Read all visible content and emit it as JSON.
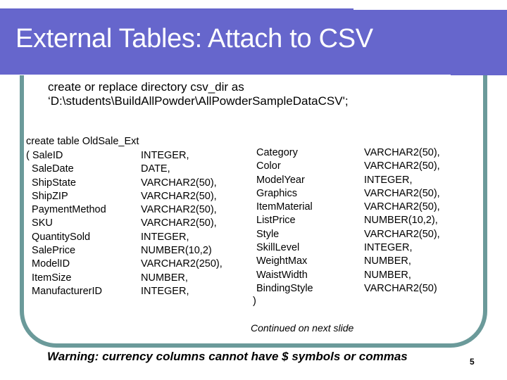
{
  "slide": {
    "title": "External Tables: Attach to CSV",
    "directory_statement": {
      "line1": "create or replace directory csv_dir as",
      "line2": "‘D:\\students\\BuildAllPowder\\AllPowderSampleDataCSV';"
    },
    "table_statement": {
      "header": "create table OldSale_Ext",
      "left_columns": [
        {
          "name": "( SaleID",
          "type": "INTEGER,"
        },
        {
          "name": "  SaleDate",
          "type": "DATE,"
        },
        {
          "name": "  ShipState",
          "type": "VARCHAR2(50),"
        },
        {
          "name": "  ShipZIP",
          "type": "VARCHAR2(50),"
        },
        {
          "name": "  PaymentMethod",
          "type": "VARCHAR2(50),"
        },
        {
          "name": "  SKU",
          "type": "VARCHAR2(50),"
        },
        {
          "name": "  QuantitySold",
          "type": "INTEGER,"
        },
        {
          "name": "  SalePrice",
          "type": "NUMBER(10,2)"
        },
        {
          "name": "  ModelID",
          "type": "VARCHAR2(250),"
        },
        {
          "name": "  ItemSize",
          "type": "NUMBER,"
        },
        {
          "name": "  ManufacturerID",
          "type": "INTEGER,"
        }
      ],
      "right_columns": [
        {
          "name": "Category",
          "type": "VARCHAR2(50),"
        },
        {
          "name": "Color",
          "type": "VARCHAR2(50),"
        },
        {
          "name": "ModelYear",
          "type": "INTEGER,"
        },
        {
          "name": "Graphics",
          "type": "VARCHAR2(50),"
        },
        {
          "name": "ItemMaterial",
          "type": "VARCHAR2(50),"
        },
        {
          "name": "ListPrice",
          "type": "NUMBER(10,2),"
        },
        {
          "name": "Style",
          "type": "VARCHAR2(50),"
        },
        {
          "name": "SkillLevel",
          "type": "INTEGER,"
        },
        {
          "name": "WeightMax",
          "type": "NUMBER,"
        },
        {
          "name": "WaistWidth",
          "type": "NUMBER,"
        },
        {
          "name": "BindingStyle",
          "type": "VARCHAR2(50)"
        }
      ],
      "closing": ")"
    },
    "continued_note": "Continued on next slide",
    "warning": "Warning: currency columns cannot have $ symbols or commas",
    "page_number": "5"
  },
  "colors": {
    "title_band": "#6666cc",
    "border": "#6b9a9a"
  }
}
